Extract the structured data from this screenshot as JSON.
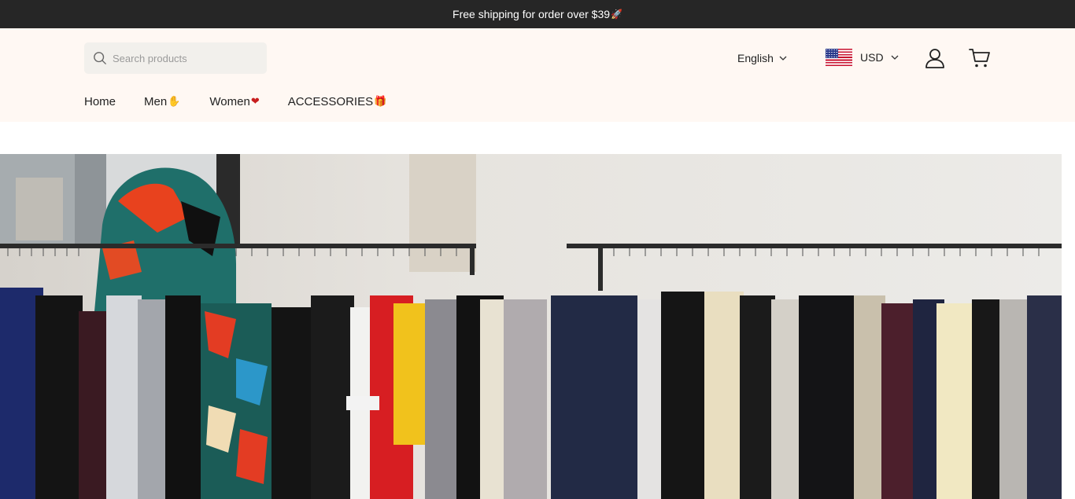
{
  "announcement": {
    "text": "Free shipping for order over $39",
    "icon": "rocket-emoji"
  },
  "header": {
    "search": {
      "placeholder": "Search products",
      "value": "",
      "icon": "search-icon"
    },
    "language": {
      "selected": "English"
    },
    "currency": {
      "selected": "USD",
      "flag": "us-flag-icon"
    },
    "account_icon": "user-icon",
    "cart_icon": "cart-icon"
  },
  "nav": {
    "items": [
      {
        "label": "Home"
      },
      {
        "label": "Men",
        "emoji": "✋"
      },
      {
        "label": "Women",
        "emoji": "❤"
      },
      {
        "label": "ACCESSORIES",
        "emoji": "🎁"
      }
    ]
  },
  "hero": {
    "alt": "clothing-racks-photo"
  },
  "colors": {
    "announcement_bg": "#262626",
    "header_bg": "#fff8f3",
    "search_bg": "#f2f0ec",
    "text": "#222222"
  }
}
